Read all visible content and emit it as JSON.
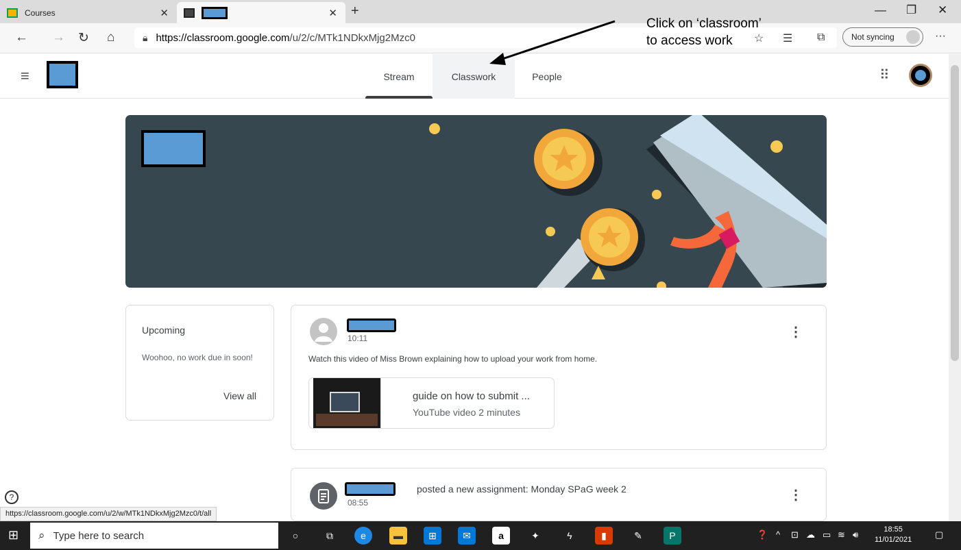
{
  "browser": {
    "tabs": [
      {
        "label": "Courses"
      },
      {
        "label": ""
      }
    ],
    "new_tab": "+",
    "url_host": "https://classroom.google.com",
    "url_path": "/u/2/c/MTk1NDkxMjg2Mzc0",
    "sync_label": "Not syncing",
    "status_url": "https://classroom.google.com/u/2/w/MTk1NDkxMjg2Mzc0/t/all"
  },
  "annotation": {
    "line1": "Click on ‘classroom’",
    "line2": "to access work"
  },
  "nav": {
    "stream": "Stream",
    "classwork": "Classwork",
    "people": "People"
  },
  "upcoming": {
    "title": "Upcoming",
    "body": "Woohoo, no work due in soon!",
    "view_all": "View all"
  },
  "posts": [
    {
      "time": "10:11",
      "message": "Watch this video of Miss Brown explaining how to upload your work from home.",
      "attachment_title": "guide on how to submit ...",
      "attachment_meta": "YouTube video  2 minutes"
    },
    {
      "time": "08:55",
      "text": "posted a new assignment: Monday SPaG week 2"
    }
  ],
  "taskbar": {
    "search_placeholder": "Type here to search",
    "time": "18:55",
    "date": "11/01/2021"
  },
  "colors": {
    "redaction": "#5b9bd5",
    "banner": "#37474f",
    "gold": "#f6c955"
  }
}
